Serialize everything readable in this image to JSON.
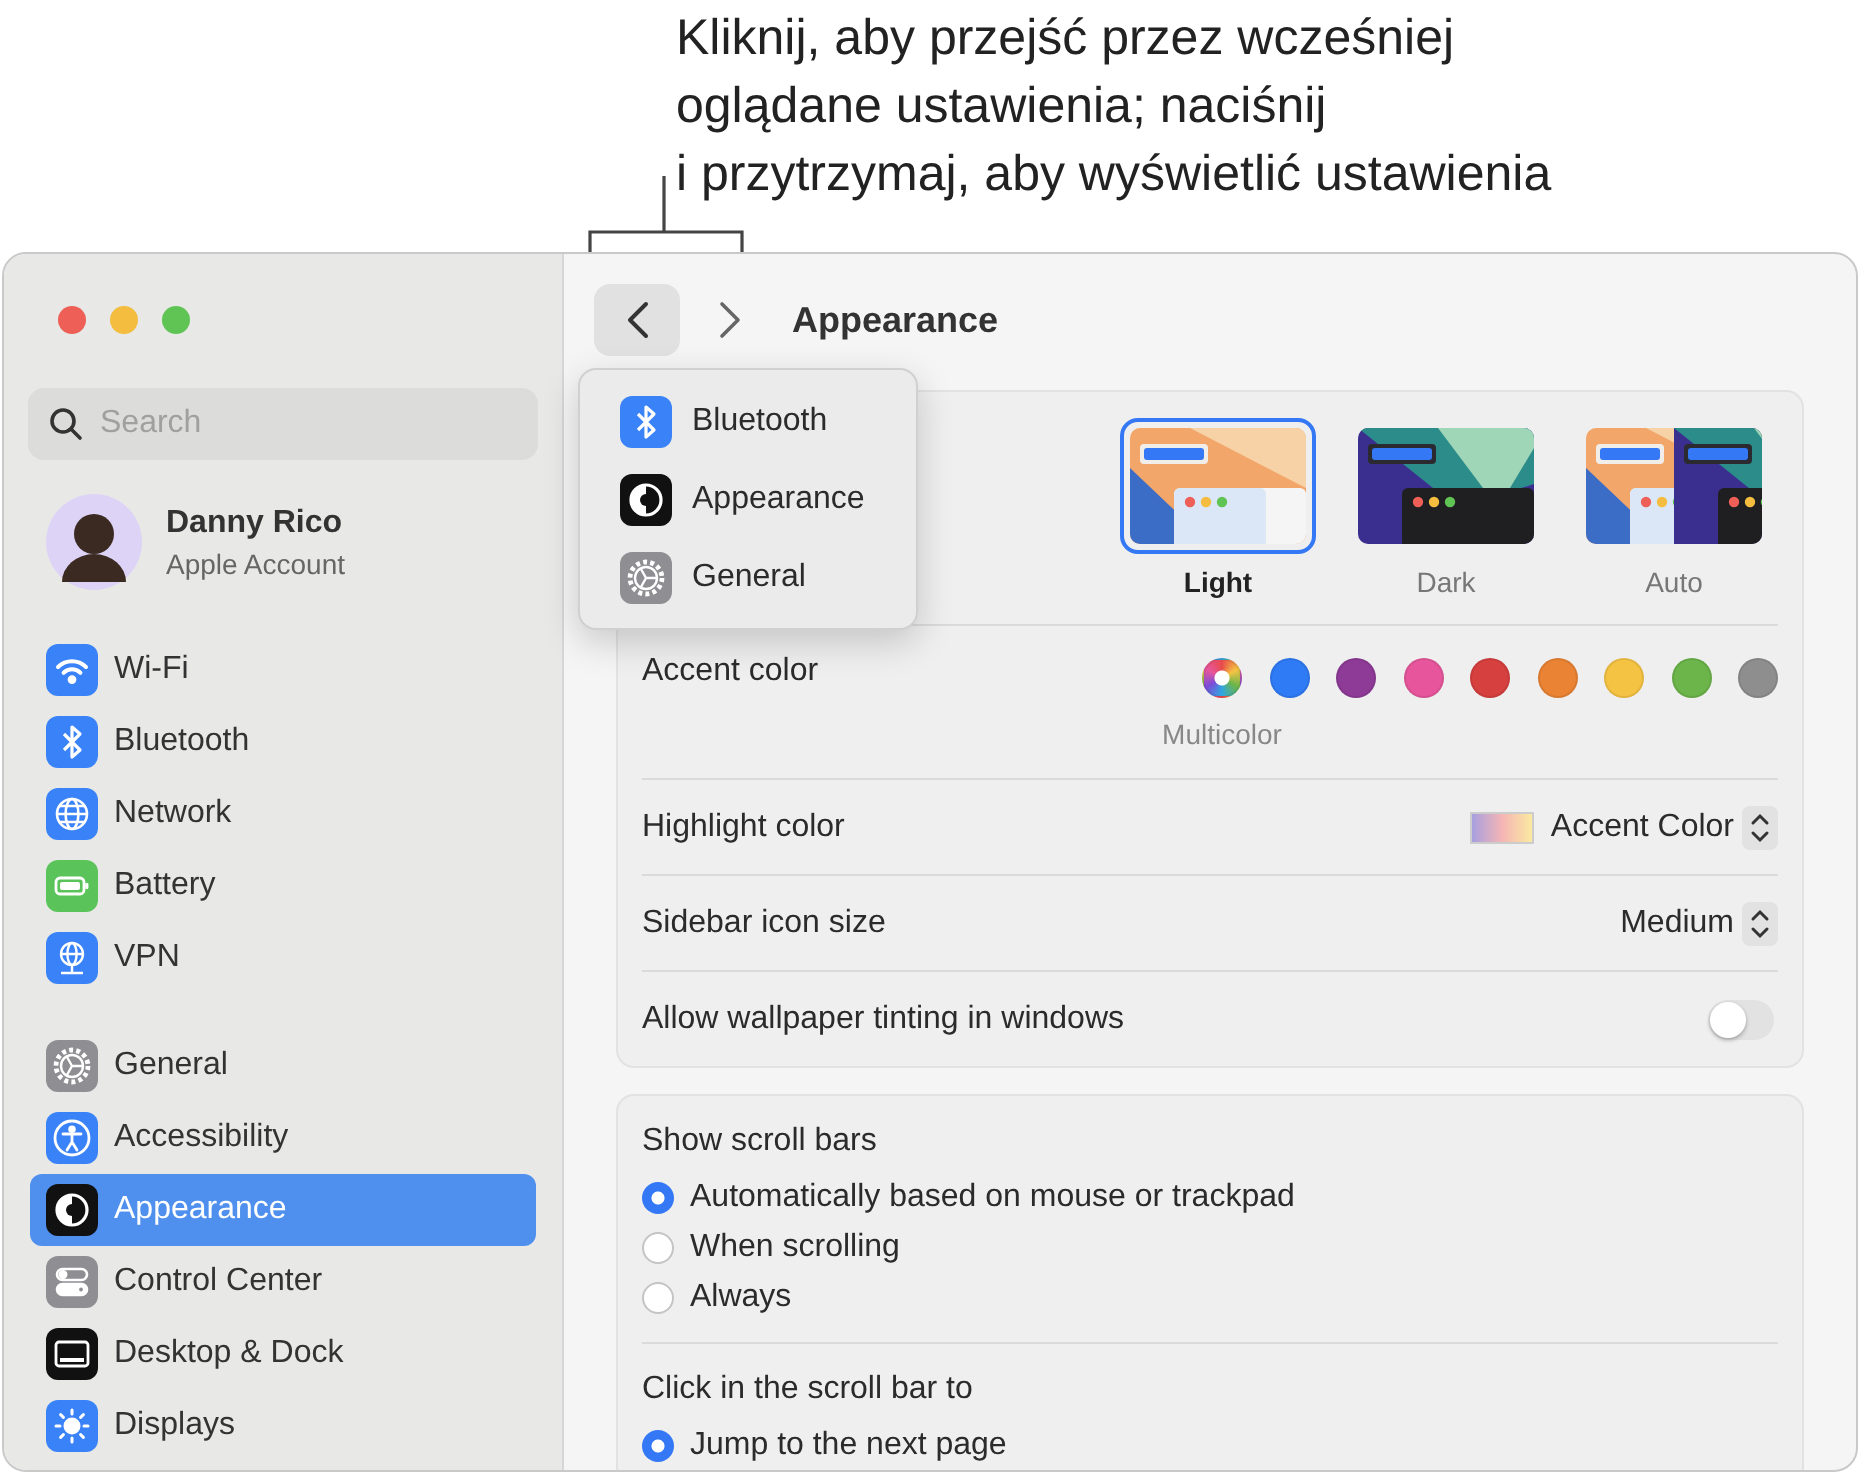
{
  "callout": {
    "lines": [
      "Kliknij, aby przejść przez wcześniej",
      "oglądane ustawienia; naciśnij",
      "i przytrzymaj, aby wyświetlić ustawienia"
    ]
  },
  "sidebar": {
    "search": {
      "placeholder": "Search"
    },
    "account": {
      "name": "Danny Rico",
      "subtitle": "Apple Account"
    },
    "groups": [
      {
        "items": [
          {
            "label": "Wi-Fi",
            "kind": "wifi",
            "selected": false
          },
          {
            "label": "Bluetooth",
            "kind": "bluetooth",
            "selected": false
          },
          {
            "label": "Network",
            "kind": "network",
            "selected": false
          },
          {
            "label": "Battery",
            "kind": "battery",
            "selected": false
          },
          {
            "label": "VPN",
            "kind": "vpn",
            "selected": false
          }
        ]
      },
      {
        "items": [
          {
            "label": "General",
            "kind": "general",
            "selected": false
          },
          {
            "label": "Accessibility",
            "kind": "accessibility",
            "selected": false
          },
          {
            "label": "Appearance",
            "kind": "appearance",
            "selected": true
          },
          {
            "label": "Control Center",
            "kind": "control",
            "selected": false
          },
          {
            "label": "Desktop & Dock",
            "kind": "dock",
            "selected": false
          },
          {
            "label": "Displays",
            "kind": "displays",
            "selected": false
          }
        ]
      }
    ]
  },
  "toolbar": {
    "title": "Appearance"
  },
  "history_menu": {
    "open": true,
    "items": [
      {
        "label": "Bluetooth",
        "kind": "bluetooth"
      },
      {
        "label": "Appearance",
        "kind": "appearance"
      },
      {
        "label": "General",
        "kind": "general"
      }
    ]
  },
  "appearance": {
    "themes": [
      {
        "label": "Light",
        "kind": "light",
        "selected": true
      },
      {
        "label": "Dark",
        "kind": "dark",
        "selected": false
      },
      {
        "label": "Auto",
        "kind": "auto",
        "selected": false
      }
    ],
    "accent": {
      "label": "Accent color",
      "colors": [
        {
          "kind": "multicolor",
          "name": "Multicolor",
          "selected": true
        },
        {
          "kind": "solid",
          "color": "#2f7bf5",
          "selected": false
        },
        {
          "kind": "solid",
          "color": "#8e3a97",
          "selected": false
        },
        {
          "kind": "solid",
          "color": "#e7569c",
          "selected": false
        },
        {
          "kind": "solid",
          "color": "#d6403f",
          "selected": false
        },
        {
          "kind": "solid",
          "color": "#ea8333",
          "selected": false
        },
        {
          "kind": "solid",
          "color": "#f5c343",
          "selected": false
        },
        {
          "kind": "solid",
          "color": "#6bb54a",
          "selected": false
        },
        {
          "kind": "solid",
          "color": "#8e8e8e",
          "selected": false
        }
      ]
    },
    "highlight": {
      "label": "Highlight color",
      "value": "Accent Color"
    },
    "icon_size": {
      "label": "Sidebar icon size",
      "value": "Medium"
    },
    "tinting": {
      "label": "Allow wallpaper tinting in windows",
      "on": false
    }
  },
  "scroll_bars": {
    "label": "Show scroll bars",
    "options": [
      {
        "label": "Automatically based on mouse or trackpad",
        "selected": true
      },
      {
        "label": "When scrolling",
        "selected": false
      },
      {
        "label": "Always",
        "selected": false
      }
    ]
  },
  "scroll_click": {
    "label": "Click in the scroll bar to",
    "options": [
      {
        "label": "Jump to the next page",
        "selected": true
      }
    ]
  }
}
